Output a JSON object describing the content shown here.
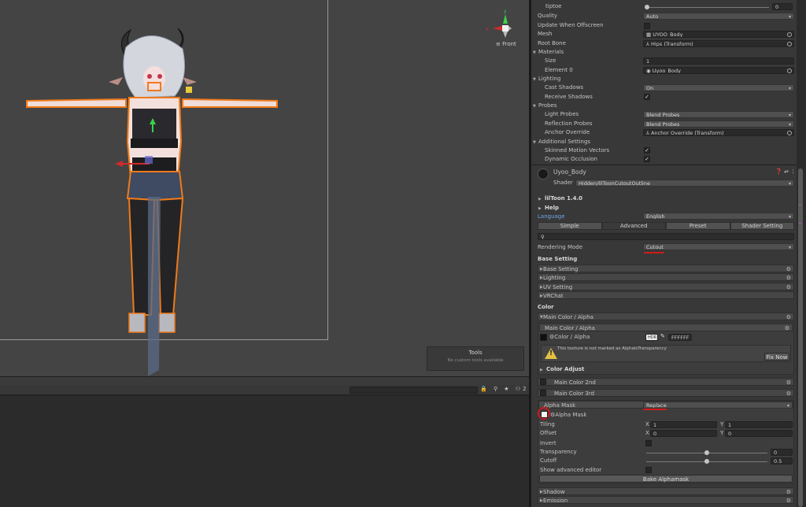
{
  "scene": {
    "gizmo_label": "Front",
    "gizmo_axes": {
      "y": "y",
      "x": "x"
    },
    "tools_title": "Tools",
    "tools_subtitle": "No custom tools available"
  },
  "lower_panel": {
    "icons": "🔒 ⚲ ★ ⚇2"
  },
  "inspector": {
    "top_rows": [
      {
        "label": "tiptoe",
        "value": "0"
      }
    ],
    "renderer": {
      "quality_label": "Quality",
      "quality_value": "Auto",
      "offscreen_label": "Update When Offscreen",
      "mesh_label": "Mesh",
      "mesh_value": "UYOO_Body",
      "rootbone_label": "Root Bone",
      "rootbone_value": "Hips (Transform)",
      "materials_label": "Materials",
      "size_label": "Size",
      "size_value": "1",
      "element0_label": "Element 0",
      "element0_value": "Uyoo_Body",
      "lighting_label": "Lighting",
      "cast_label": "Cast Shadows",
      "cast_value": "On",
      "receive_label": "Receive Shadows",
      "probes_label": "Probes",
      "lightprobes_label": "Light Probes",
      "lightprobes_value": "Blend Probes",
      "reflprobes_label": "Reflection Probes",
      "reflprobes_value": "Blend Probes",
      "anchor_label": "Anchor Override",
      "anchor_value": "Anchor Override (Transform)",
      "additional_label": "Additional Settings",
      "skinned_label": "Skinned Motion Vectors",
      "dynamic_label": "Dynamic Occlusion"
    },
    "material": {
      "name": "Uyoo_Body",
      "shader_label": "Shader",
      "shader_value": "Hidden/lilToonCutoutOutline",
      "liltoon_version": "lilToon 1.4.0",
      "help_label": "Help",
      "language_label": "Language",
      "language_value": "English",
      "tabs": [
        "Simple",
        "Advanced",
        "Preset",
        "Shader Setting"
      ],
      "rendering_mode_label": "Rendering Mode",
      "rendering_mode_value": "Cutout",
      "base_setting_header": "Base Setting",
      "base_sections": [
        "Base Setting",
        "Lighting",
        "UV Setting",
        "VRChat"
      ],
      "color_header": "Color",
      "main_color_alpha": "Main Color / Alpha",
      "main_color_alpha_inner": "Main Color / Alpha",
      "color_alpha_label": "Color / Alpha",
      "hdr_label": "HDR",
      "hex_value": "FFFFFF",
      "warning_text": "This texture is not marked as AlphaIsTransparency",
      "fix_now": "Fix Now",
      "color_adjust": "Color Adjust",
      "main_color_2nd": "Main Color 2nd",
      "main_color_3rd": "Main Color 3rd",
      "alpha_mask_label": "Alpha Mask",
      "alpha_mask_mode": "Replace",
      "alpha_mask_tex_label": "Alpha Mask",
      "tiling_label": "Tiling",
      "tiling_x_label": "X",
      "tiling_x": "1",
      "tiling_y_label": "Y",
      "tiling_y": "1",
      "offset_label": "Offset",
      "offset_x_label": "X",
      "offset_x": "0",
      "offset_y_label": "Y",
      "offset_y": "0",
      "invert_label": "Invert",
      "transparency_label": "Transparency",
      "transparency_value": "0",
      "cutoff_label": "Cutoff",
      "cutoff_value": "0.5",
      "advanced_editor_label": "Show advanced editor",
      "bake_button": "Bake Alphamask",
      "shadow_label": "Shadow",
      "emission_label": "Emission"
    },
    "colors": {
      "accent_red": "#d11a1a",
      "link_blue": "#6fa6e8",
      "warning_yellow": "#e2c044"
    }
  }
}
